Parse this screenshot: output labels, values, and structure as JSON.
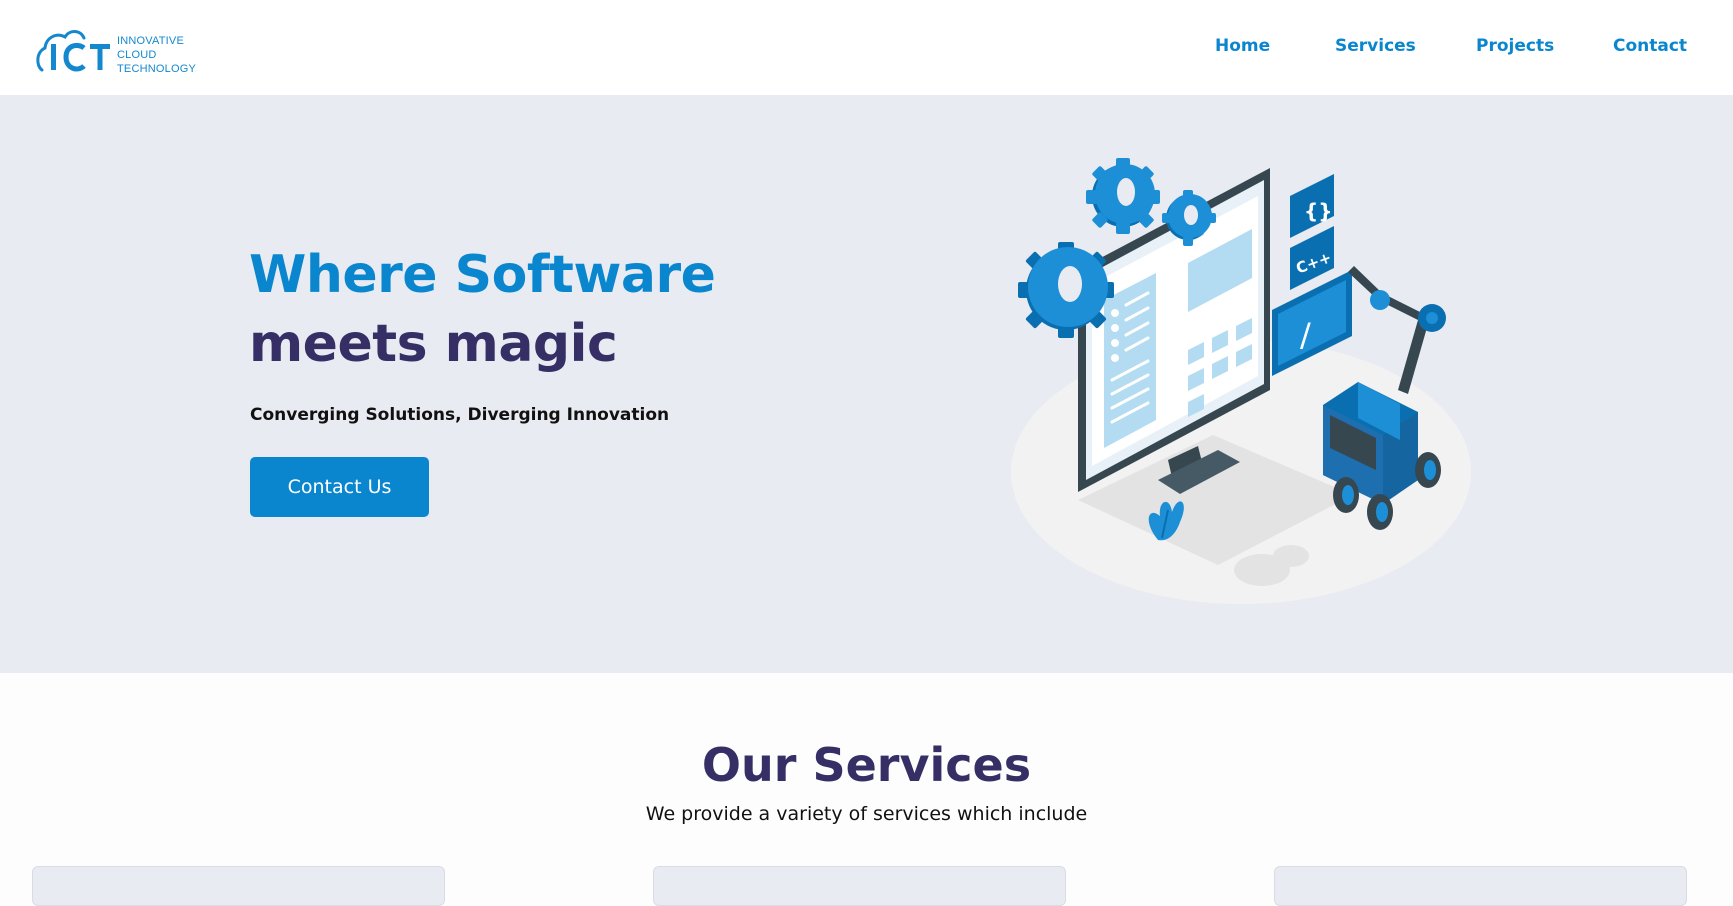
{
  "header": {
    "logo": {
      "mark": "ICT",
      "lines": [
        "INNOVATIVE",
        "CLOUD",
        "TECHNOLOGY"
      ]
    },
    "nav": [
      {
        "label": "Home"
      },
      {
        "label": "Services"
      },
      {
        "label": "Projects"
      },
      {
        "label": "Contact"
      }
    ]
  },
  "hero": {
    "title_line_1": "Where Software",
    "title_line_2": "meets magic",
    "subtitle": "Converging Solutions, Diverging Innovation",
    "cta_label": "Contact Us",
    "illustration": {
      "icon": "software-robot-illustration",
      "badges": [
        "{}",
        "C++",
        "/"
      ]
    }
  },
  "services": {
    "title": "Our Services",
    "subtitle": "We provide a variety of services which include"
  },
  "colors": {
    "brand_blue": "#0a86cf",
    "heading_navy": "#352f66",
    "hero_bg": "#e9ebf2"
  }
}
